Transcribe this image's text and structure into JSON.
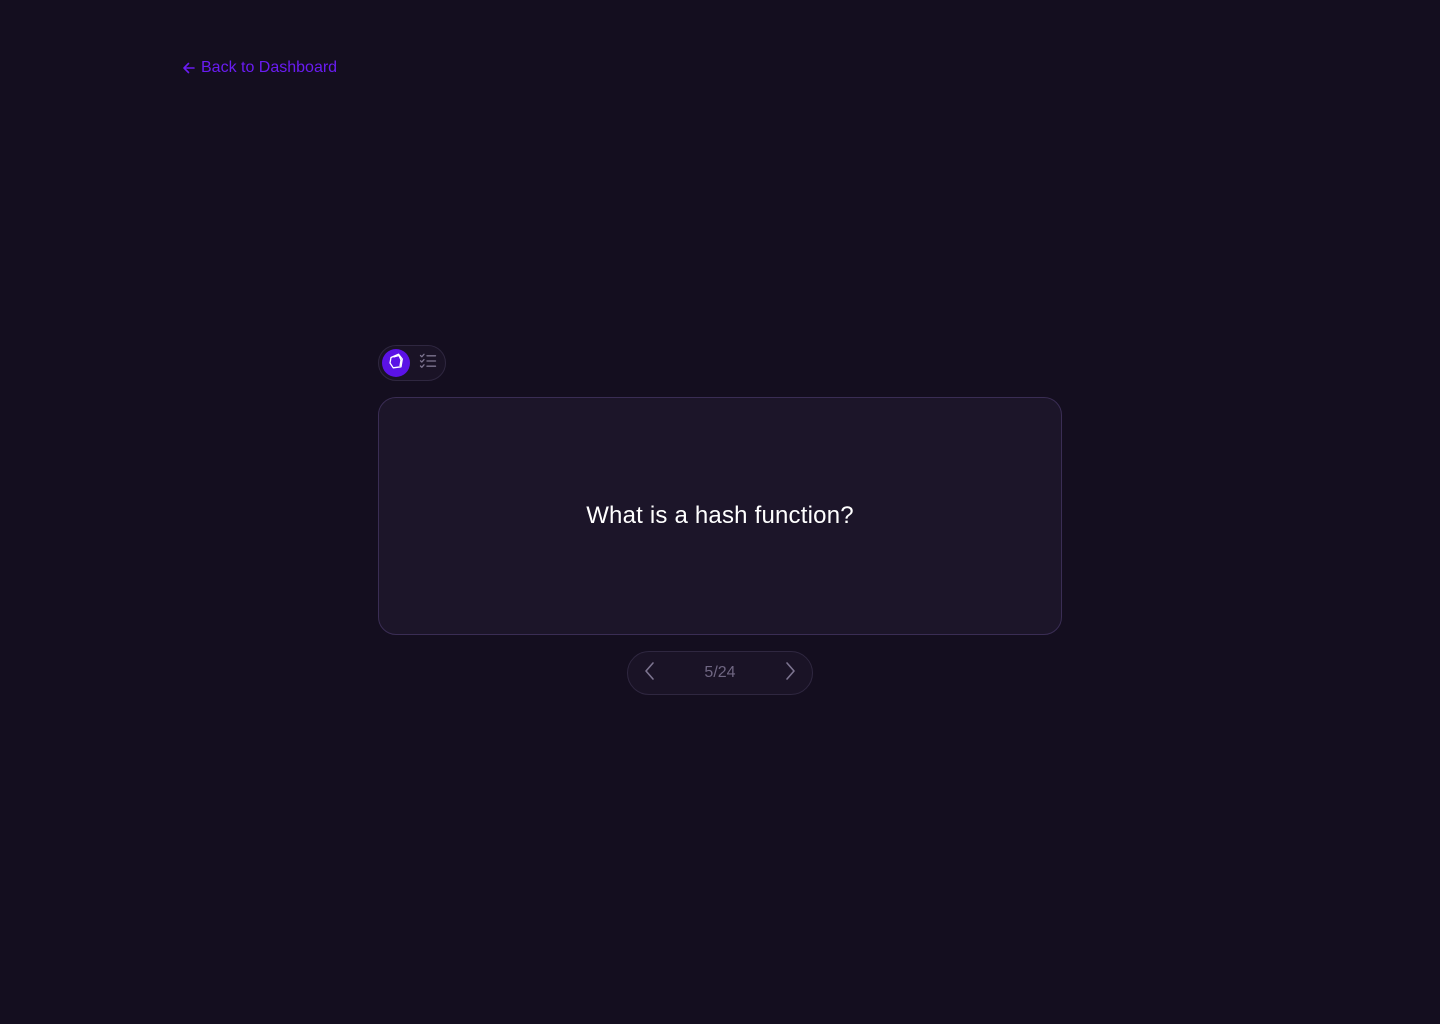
{
  "nav": {
    "back_label": "Back to Dashboard",
    "back_icon": "arrow-left-icon"
  },
  "mode_toggle": {
    "options": [
      {
        "name": "flashcard-mode",
        "icon": "cards-icon",
        "active": true
      },
      {
        "name": "list-mode",
        "icon": "checklist-icon",
        "active": false
      }
    ]
  },
  "card": {
    "question": "What is a hash function?"
  },
  "pager": {
    "current": 5,
    "total": 24,
    "label": "5/24",
    "prev_icon": "chevron-left-icon",
    "next_icon": "chevron-right-icon"
  },
  "colors": {
    "background": "#140e1f",
    "accent": "#6a1cf2",
    "card_bg": "#1c1529",
    "card_border": "#3a2d54",
    "muted_text": "#6f6682"
  }
}
